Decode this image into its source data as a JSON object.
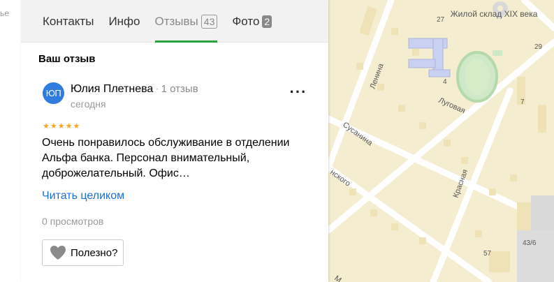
{
  "edge_text": "ье",
  "tabs": [
    {
      "label": "Контакты"
    },
    {
      "label": "Инфо"
    },
    {
      "label": "Отзывы",
      "badge": "43"
    },
    {
      "label": "Фото",
      "badge": "2"
    }
  ],
  "section_title": "Ваш отзыв",
  "review": {
    "avatar_initials": "ЮП",
    "author": "Юлия Плетнева",
    "separator": "·",
    "review_count": "1 отзыв",
    "date": "сегодня",
    "more_label": "···",
    "rating": 5,
    "text": "Очень понравилось обслуживание в отделении Альфа банка. Персонал внимательный, доброжелательный. Офис…",
    "read_more": "Читать целиком",
    "views": "0 просмотров",
    "helpful_label": "Полезно?"
  },
  "map": {
    "labels": {
      "warehouse": "Жилой склад XIX века",
      "lenina": "Ленина",
      "lugovaya": "Луговая",
      "susanina": "Сусанина",
      "krasnaya": "Красная",
      "nskogo": "нского",
      "m": "М",
      "n27": "27",
      "n29": "29",
      "n4": "4",
      "n7": "7",
      "n43_6": "43/6",
      "n57": "57"
    }
  }
}
